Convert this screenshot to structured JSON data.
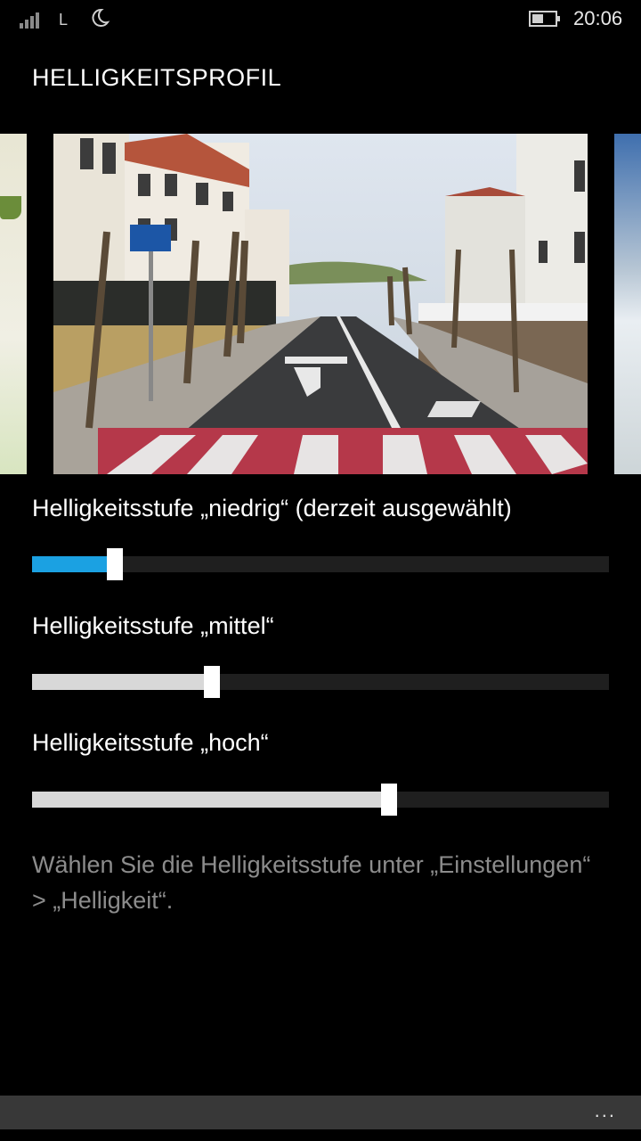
{
  "status": {
    "network": "L",
    "time": "20:06",
    "icons": [
      "signal-bars-icon",
      "moon-icon",
      "battery-icon"
    ]
  },
  "page": {
    "title": "HELLIGKEITSPROFIL"
  },
  "sliders": [
    {
      "label": "Helligkeitsstufe „niedrig“ (derzeit ausgewählt)",
      "value": 0.143,
      "fill_color": "#1ba1e2"
    },
    {
      "label": "Helligkeitsstufe „mittel“",
      "value": 0.312,
      "fill_color": "#d8d8d8"
    },
    {
      "label": "Helligkeitsstufe „hoch“",
      "value": 0.619,
      "fill_color": "#d8d8d8"
    }
  ],
  "hint": "Wählen Sie die Helligkeitsstufe unter „Einstellungen“ > „Helligkeit“.",
  "appbar": {
    "more": "..."
  },
  "colors": {
    "accent": "#1ba1e2",
    "track": "#1f1f1f",
    "appbar": "#383838"
  }
}
